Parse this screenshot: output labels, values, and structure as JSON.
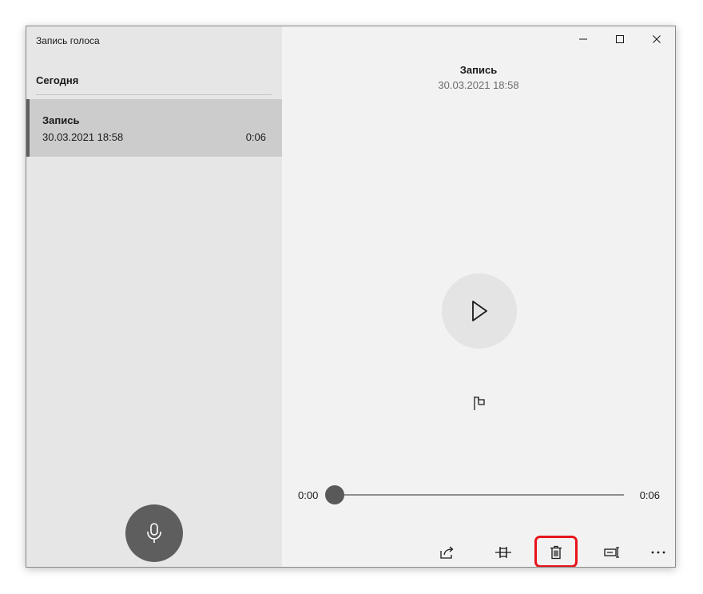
{
  "app": {
    "title": "Запись голоса"
  },
  "sidebar": {
    "group_header": "Сегодня",
    "items": [
      {
        "name": "Запись",
        "date": "30.03.2021 18:58",
        "duration": "0:06",
        "selected": true
      }
    ],
    "record_button_icon": "microphone-icon"
  },
  "window_controls": {
    "minimize_icon": "minimize-icon",
    "maximize_icon": "maximize-icon",
    "close_icon": "close-icon"
  },
  "player": {
    "title": "Запись",
    "date": "30.03.2021 18:58",
    "current_time": "0:00",
    "total_time": "0:06",
    "progress": 0,
    "play_icon": "play-icon",
    "marker_icon": "flag-icon"
  },
  "toolbar": {
    "items": [
      {
        "icon": "share-icon"
      },
      {
        "icon": "trim-icon"
      },
      {
        "icon": "trash-icon",
        "highlighted": true
      },
      {
        "icon": "rename-icon"
      },
      {
        "icon": "more-icon"
      }
    ]
  },
  "colors": {
    "highlight": "#e8141b",
    "sidebar_bg": "#e6e6e6",
    "selected_bg": "#cccccc",
    "main_bg": "#f2f2f2",
    "mic_button": "#5e5e5e",
    "slider_thumb": "#595959"
  }
}
